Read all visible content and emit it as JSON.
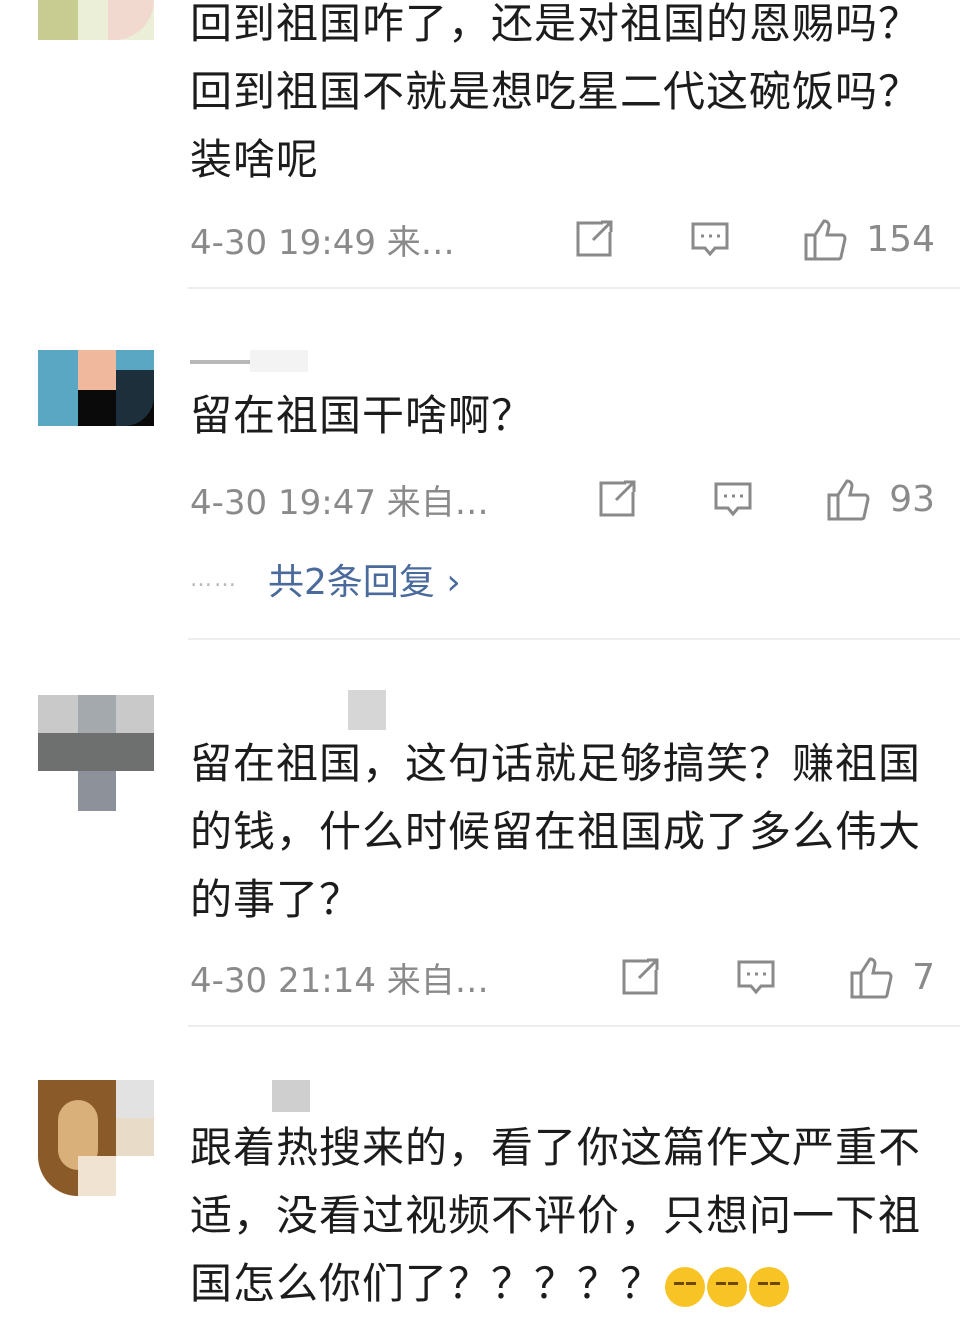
{
  "comments": [
    {
      "text": "回到祖国咋了，还是对祖国的恩赐吗？回到祖国不就是想吃星二代这碗饭吗？装啥呢",
      "time": "4-30 19:49 来…",
      "likes": "154"
    },
    {
      "text": "留在祖国干啥啊？",
      "time": "4-30 19:47 来自…",
      "likes": "93",
      "replies": "共2条回复 ›",
      "replies_dots": "……"
    },
    {
      "text": "留在祖国，这句话就足够搞笑？赚祖国的钱，什么时候留在祖国成了多么伟大的事了？",
      "time": "4-30 21:14 来自…",
      "likes": "7"
    },
    {
      "text": "跟着热搜来的，看了你这篇作文严重不适，没看过视频不评价，只想问一下祖国怎么你们了？？？？？",
      "emoji": [
        "thinking-face",
        "thinking-face",
        "thinking-face"
      ]
    }
  ],
  "colors": {
    "link": "#4a6a9c",
    "meta": "#8a8a8a",
    "divider": "#ededed"
  },
  "icons": [
    "share-icon",
    "comment-icon",
    "like-icon"
  ]
}
